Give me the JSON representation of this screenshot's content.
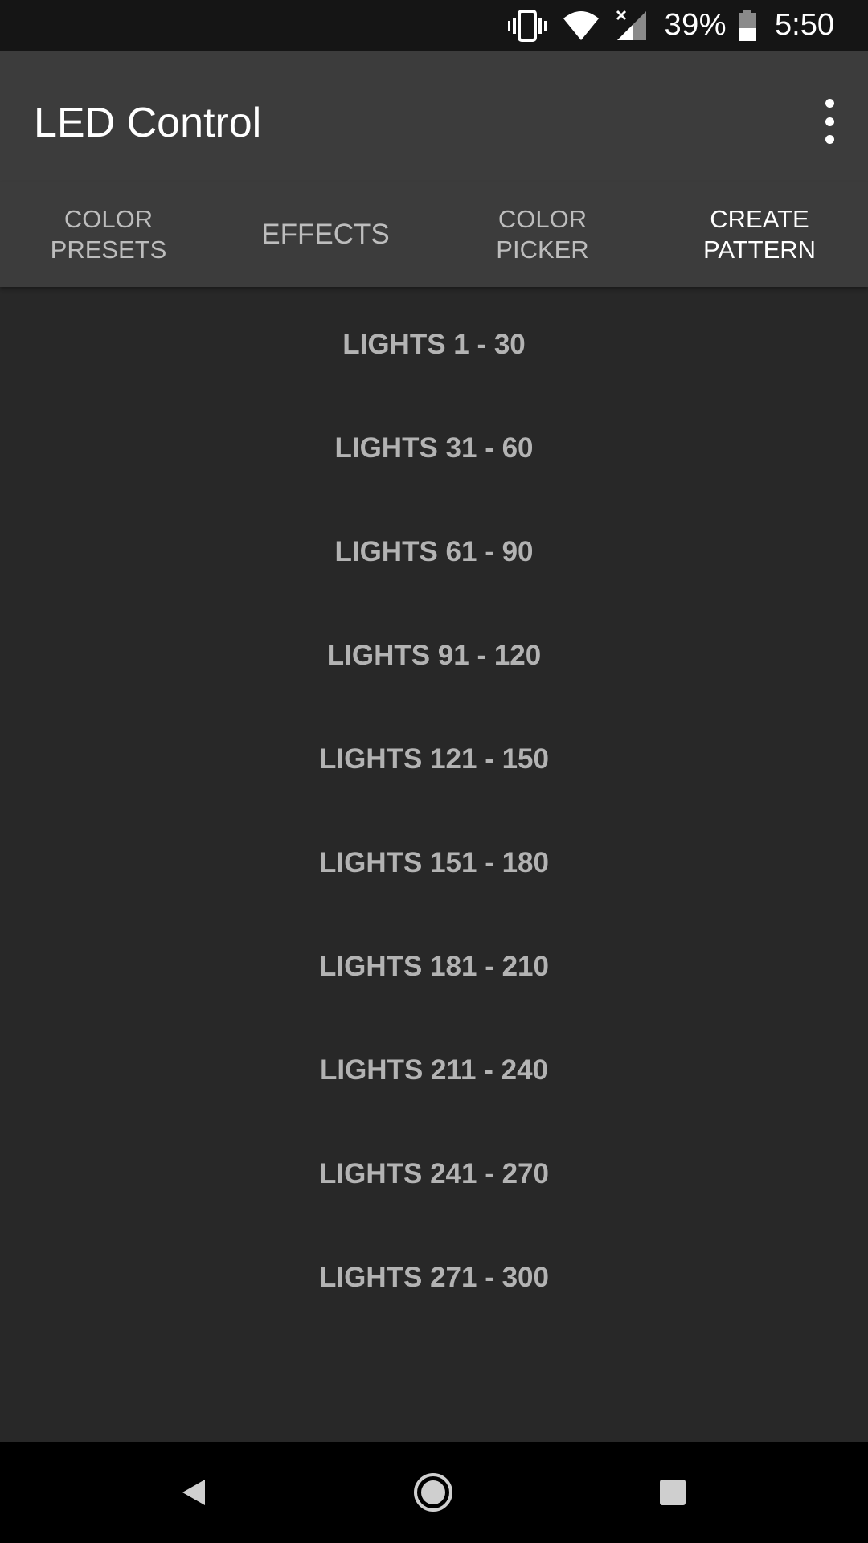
{
  "status_bar": {
    "battery_percent": "39%",
    "time": "5:50",
    "icons": [
      "vibrate-icon",
      "wifi-icon",
      "signal-icon",
      "battery-icon"
    ]
  },
  "app_bar": {
    "title": "LED Control",
    "overflow_icon": "more-vert-icon"
  },
  "tabs": [
    {
      "label": "COLOR\nPRESETS",
      "active": false
    },
    {
      "label": "EFFECTS",
      "active": false
    },
    {
      "label": "COLOR\nPICKER",
      "active": false
    },
    {
      "label": "CREATE\nPATTERN",
      "active": true
    }
  ],
  "lights": [
    {
      "label": "LIGHTS 1 - 30"
    },
    {
      "label": "LIGHTS 31 - 60"
    },
    {
      "label": "LIGHTS 61 - 90"
    },
    {
      "label": "LIGHTS 91 - 120"
    },
    {
      "label": "LIGHTS 121 - 150"
    },
    {
      "label": "LIGHTS 151 - 180"
    },
    {
      "label": "LIGHTS 181 - 210"
    },
    {
      "label": "LIGHTS 211 - 240"
    },
    {
      "label": "LIGHTS 241 - 270"
    },
    {
      "label": "LIGHTS 271 - 300"
    }
  ],
  "nav_bar": {
    "back": "back-icon",
    "home": "home-icon",
    "recents": "recents-icon"
  },
  "colors": {
    "background": "#282828",
    "app_bar": "#3c3c3c",
    "status_bar": "#151515",
    "tab_inactive": "#bdbdbd",
    "tab_active": "#ffffff",
    "list_text": "#b3b3b3"
  }
}
